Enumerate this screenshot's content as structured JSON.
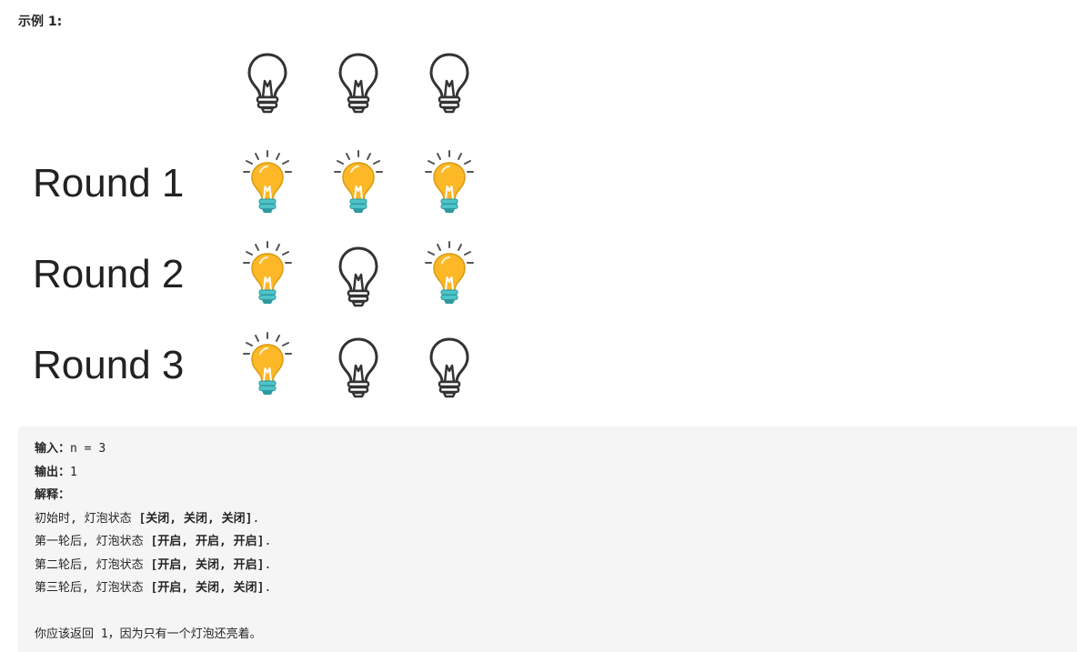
{
  "example_title": "示例 1:",
  "rows": [
    {
      "label": "",
      "states": [
        "off",
        "off",
        "off"
      ]
    },
    {
      "label": "Round 1",
      "states": [
        "on",
        "on",
        "on"
      ]
    },
    {
      "label": "Round 2",
      "states": [
        "on",
        "off",
        "on"
      ]
    },
    {
      "label": "Round 3",
      "states": [
        "on",
        "off",
        "off"
      ]
    }
  ],
  "icons": {
    "on": "lit-bulb-icon",
    "off": "unlit-bulb-icon"
  },
  "colors": {
    "bulb_on": "#fcb827",
    "bulb_base_on": "#4fc3c8",
    "bulb_off_stroke": "#333333",
    "code_bg": "#f5f5f5"
  },
  "code": {
    "input_label": "输入：",
    "input_value": "n = 3",
    "output_label": "输出：",
    "output_value": "1",
    "explain_label": "解释：",
    "lines": [
      {
        "prefix": "初始时, 灯泡状态 ",
        "state": "[关闭, 关闭, 关闭]",
        "suffix": "."
      },
      {
        "prefix": "第一轮后, 灯泡状态 ",
        "state": "[开启, 开启, 开启]",
        "suffix": "."
      },
      {
        "prefix": "第二轮后, 灯泡状态 ",
        "state": "[开启, 关闭, 开启]",
        "suffix": "."
      },
      {
        "prefix": "第三轮后, 灯泡状态 ",
        "state": "[开启, 关闭, 关闭]",
        "suffix": "."
      }
    ],
    "conclusion": "你应该返回 1，因为只有一个灯泡还亮着。"
  }
}
